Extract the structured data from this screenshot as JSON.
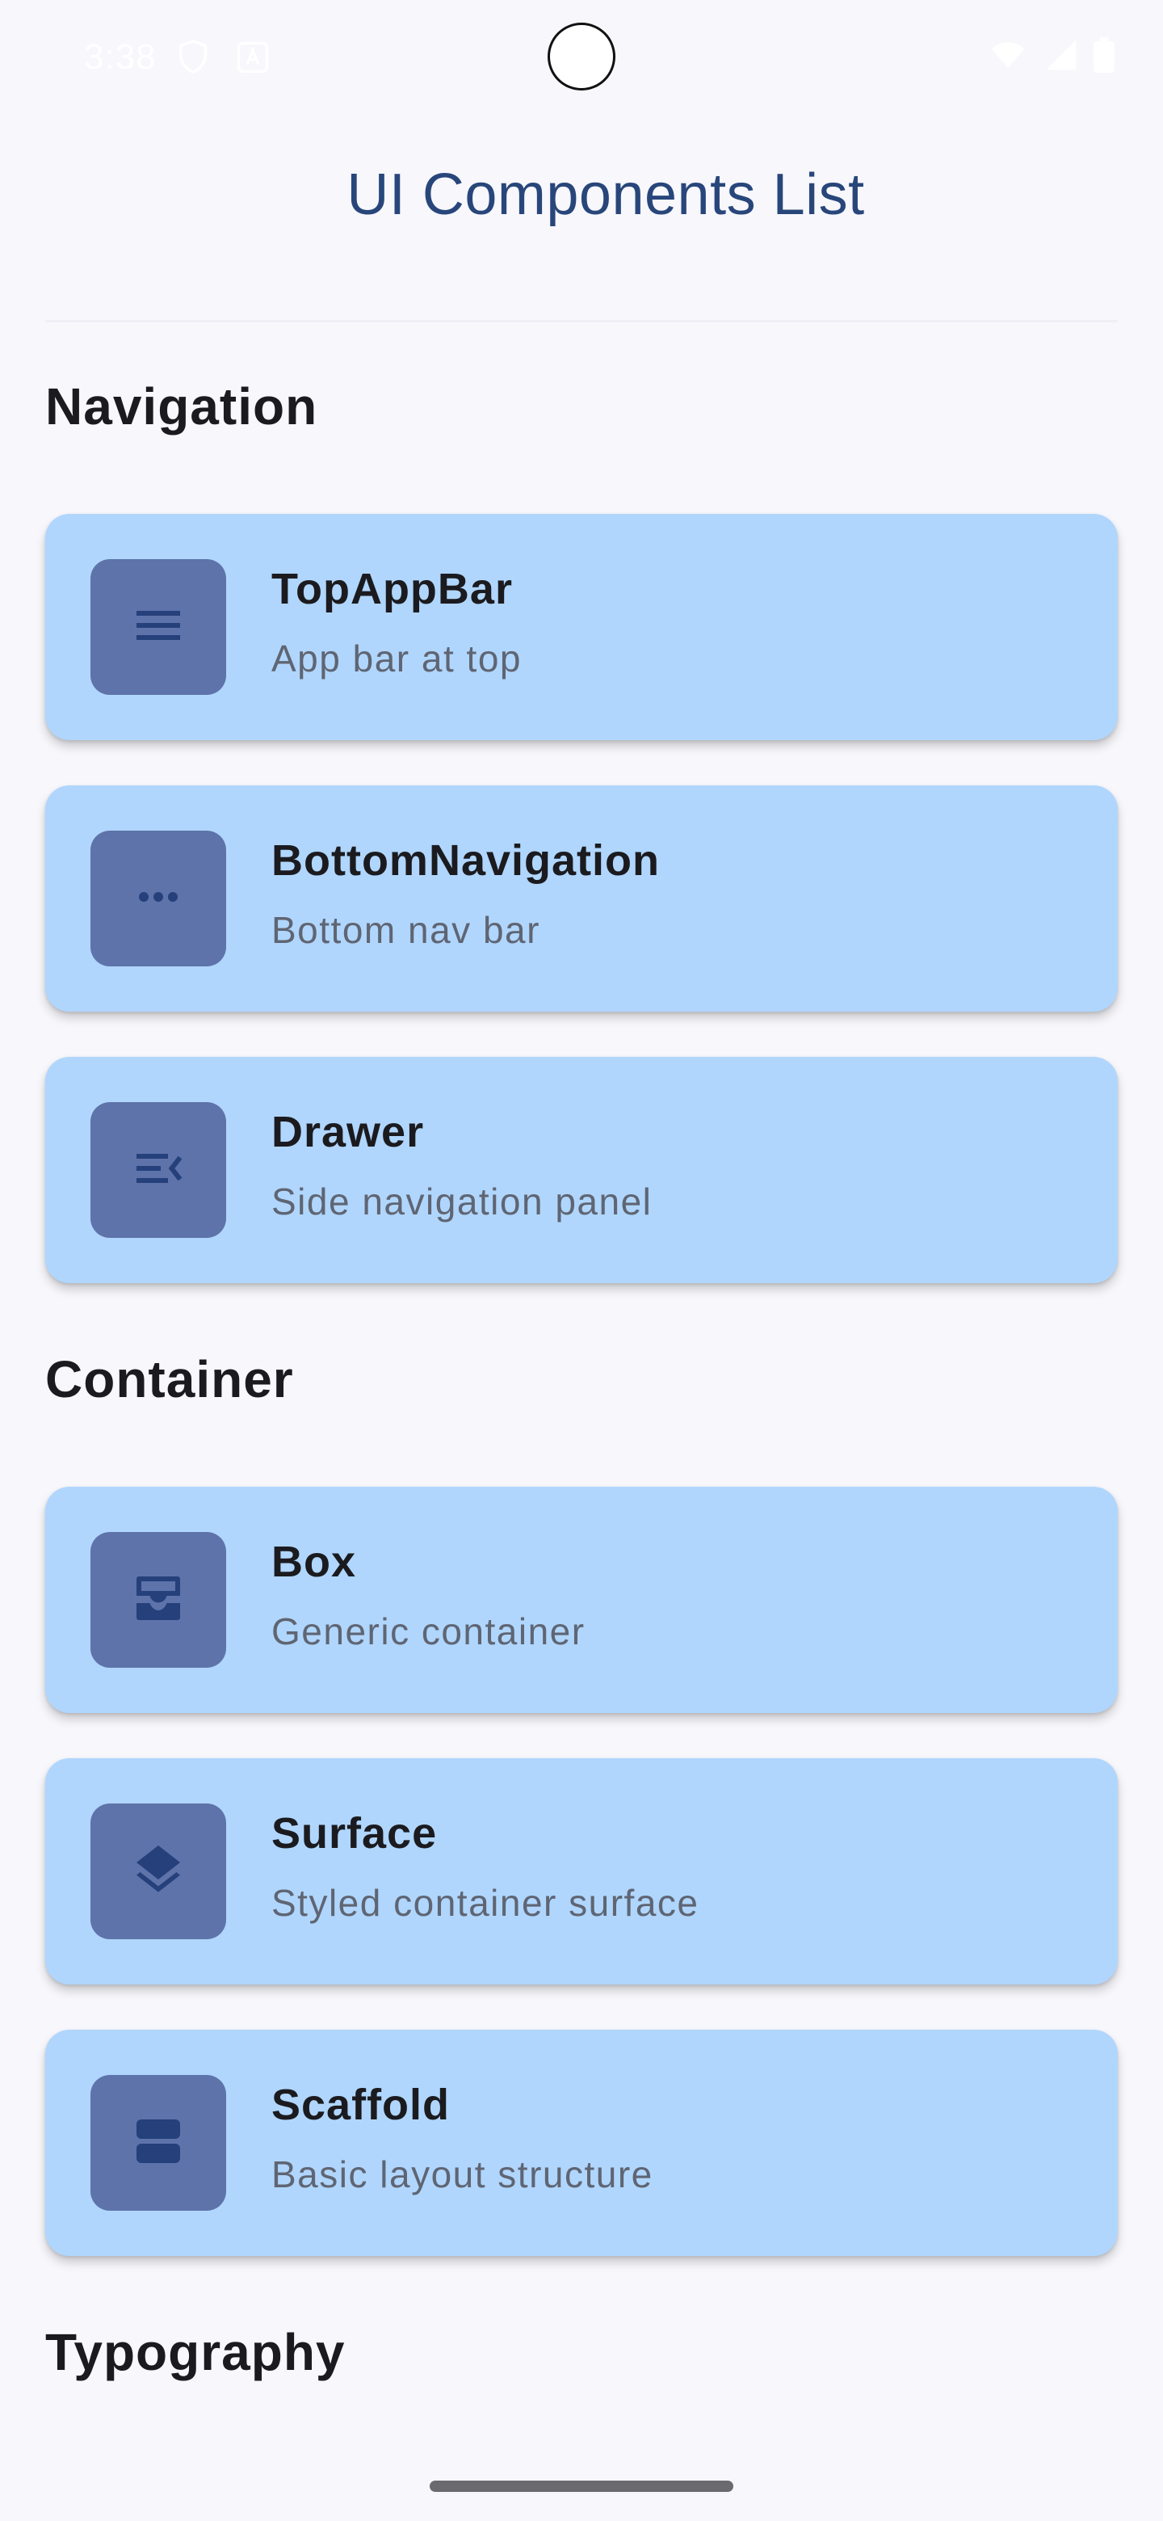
{
  "status_bar": {
    "time": "3:38",
    "icons": [
      "shield-icon",
      "a-icon",
      "wifi-icon",
      "signal-icon",
      "battery-icon"
    ]
  },
  "app": {
    "title": "UI Components List"
  },
  "sections": [
    {
      "header": "Navigation",
      "items": [
        {
          "title": "TopAppBar",
          "subtitle": "App bar at top",
          "icon": "menu-icon"
        },
        {
          "title": "BottomNavigation",
          "subtitle": "Bottom nav bar",
          "icon": "more-horiz-icon"
        },
        {
          "title": "Drawer",
          "subtitle": "Side navigation panel",
          "icon": "menu-open-icon"
        }
      ]
    },
    {
      "header": "Container",
      "items": [
        {
          "title": "Box",
          "subtitle": "Generic container",
          "icon": "inbox-icon"
        },
        {
          "title": "Surface",
          "subtitle": "Styled container surface",
          "icon": "layers-icon"
        },
        {
          "title": "Scaffold",
          "subtitle": "Basic layout structure",
          "icon": "view-agenda-icon"
        }
      ]
    },
    {
      "header": "Typography",
      "items": []
    }
  ],
  "colors": {
    "background": "#f7f7fc",
    "card": "#b0d6fd",
    "icon_tile": "#5e73aa",
    "icon_glyph": "#25407a",
    "title": "#28467a"
  }
}
